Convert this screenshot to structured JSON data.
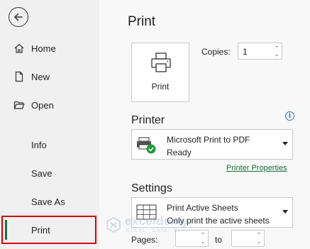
{
  "sidebar": {
    "items": [
      {
        "label": "Home",
        "icon": "home-icon"
      },
      {
        "label": "New",
        "icon": "new-document-icon"
      },
      {
        "label": "Open",
        "icon": "folder-open-icon"
      },
      {
        "label": "Info"
      },
      {
        "label": "Save"
      },
      {
        "label": "Save As"
      },
      {
        "label": "Print",
        "selected": true
      }
    ]
  },
  "main": {
    "title": "Print",
    "print_button_label": "Print",
    "copies_label": "Copies:",
    "copies_value": "1",
    "printer_heading": "Printer",
    "printer": {
      "name": "Microsoft Print to PDF",
      "status": "Ready"
    },
    "printer_properties_link": "Printer Properties",
    "settings_heading": "Settings",
    "settings": {
      "title": "Print Active Sheets",
      "desc": "Only print the active sheets"
    },
    "pages_label": "Pages:",
    "to_label": "to"
  },
  "watermark": {
    "name": "exceldemy",
    "tagline": "EXCEL · DATA · BI"
  },
  "colors": {
    "accent": "#1e7145",
    "highlight_border": "#d40000",
    "link": "#1e6a39",
    "info": "#2a72c2"
  }
}
